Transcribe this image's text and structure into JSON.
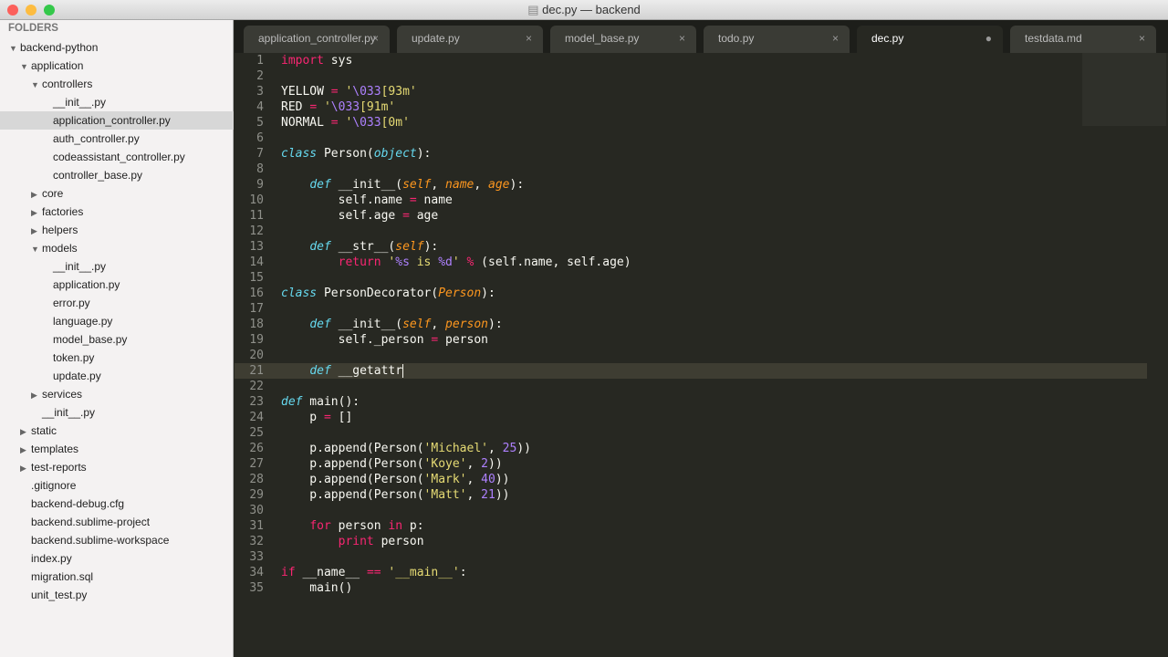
{
  "window": {
    "title": "dec.py — backend",
    "colors": {
      "close": "#fc605b",
      "min": "#fdbc40",
      "max": "#34c84a"
    }
  },
  "sidebar": {
    "header": "FOLDERS",
    "items": [
      {
        "label": "backend-python",
        "depth": 0,
        "arrow": "open"
      },
      {
        "label": "application",
        "depth": 1,
        "arrow": "open"
      },
      {
        "label": "controllers",
        "depth": 2,
        "arrow": "open"
      },
      {
        "label": "__init__.py",
        "depth": 3
      },
      {
        "label": "application_controller.py",
        "depth": 3,
        "selected": true
      },
      {
        "label": "auth_controller.py",
        "depth": 3
      },
      {
        "label": "codeassistant_controller.py",
        "depth": 3
      },
      {
        "label": "controller_base.py",
        "depth": 3
      },
      {
        "label": "core",
        "depth": 2,
        "arrow": "closed"
      },
      {
        "label": "factories",
        "depth": 2,
        "arrow": "closed"
      },
      {
        "label": "helpers",
        "depth": 2,
        "arrow": "closed"
      },
      {
        "label": "models",
        "depth": 2,
        "arrow": "open"
      },
      {
        "label": "__init__.py",
        "depth": 3
      },
      {
        "label": "application.py",
        "depth": 3
      },
      {
        "label": "error.py",
        "depth": 3
      },
      {
        "label": "language.py",
        "depth": 3
      },
      {
        "label": "model_base.py",
        "depth": 3
      },
      {
        "label": "token.py",
        "depth": 3
      },
      {
        "label": "update.py",
        "depth": 3
      },
      {
        "label": "services",
        "depth": 2,
        "arrow": "closed"
      },
      {
        "label": "__init__.py",
        "depth": 2
      },
      {
        "label": "static",
        "depth": 1,
        "arrow": "closed"
      },
      {
        "label": "templates",
        "depth": 1,
        "arrow": "closed"
      },
      {
        "label": "test-reports",
        "depth": 1,
        "arrow": "closed"
      },
      {
        "label": ".gitignore",
        "depth": 1
      },
      {
        "label": "backend-debug.cfg",
        "depth": 1
      },
      {
        "label": "backend.sublime-project",
        "depth": 1
      },
      {
        "label": "backend.sublime-workspace",
        "depth": 1
      },
      {
        "label": "index.py",
        "depth": 1
      },
      {
        "label": "migration.sql",
        "depth": 1
      },
      {
        "label": "unit_test.py",
        "depth": 1
      }
    ]
  },
  "tabs": [
    {
      "label": "application_controller.py",
      "close": "×"
    },
    {
      "label": "update.py",
      "close": "×"
    },
    {
      "label": "model_base.py",
      "close": "×"
    },
    {
      "label": "todo.py",
      "close": "×"
    },
    {
      "label": "dec.py",
      "close": "●",
      "active": true
    },
    {
      "label": "testdata.md",
      "close": "×"
    }
  ],
  "editor": {
    "current_line": 21,
    "lines": [
      [
        [
          "import",
          "k"
        ],
        [
          " sys",
          ""
        ]
      ],
      [],
      [
        [
          "YELLOW ",
          ""
        ],
        [
          "=",
          "k"
        ],
        [
          " '",
          "s"
        ],
        [
          "\\033",
          "n"
        ],
        [
          "[93m'",
          "s"
        ]
      ],
      [
        [
          "RED ",
          ""
        ],
        [
          "=",
          "k"
        ],
        [
          " '",
          "s"
        ],
        [
          "\\033",
          "n"
        ],
        [
          "[91m'",
          "s"
        ]
      ],
      [
        [
          "NORMAL ",
          ""
        ],
        [
          "=",
          "k"
        ],
        [
          " '",
          "s"
        ],
        [
          "\\033",
          "n"
        ],
        [
          "[0m'",
          "s"
        ]
      ],
      [],
      [
        [
          "class",
          "t"
        ],
        [
          " Person(",
          ""
        ],
        [
          "object",
          "t"
        ],
        [
          "):",
          ""
        ]
      ],
      [],
      [
        [
          "    ",
          ""
        ],
        [
          "def",
          "t"
        ],
        [
          " __init__(",
          ""
        ],
        [
          "self",
          "p"
        ],
        [
          ", ",
          ""
        ],
        [
          "name",
          "p"
        ],
        [
          ", ",
          ""
        ],
        [
          "age",
          "p"
        ],
        [
          "):",
          ""
        ]
      ],
      [
        [
          "        self.name ",
          ""
        ],
        [
          "=",
          "k"
        ],
        [
          " name",
          ""
        ]
      ],
      [
        [
          "        self.age ",
          ""
        ],
        [
          "=",
          "k"
        ],
        [
          " age",
          ""
        ]
      ],
      [],
      [
        [
          "    ",
          ""
        ],
        [
          "def",
          "t"
        ],
        [
          " __str__(",
          ""
        ],
        [
          "self",
          "p"
        ],
        [
          "):",
          ""
        ]
      ],
      [
        [
          "        ",
          ""
        ],
        [
          "return",
          "k"
        ],
        [
          " '",
          "s"
        ],
        [
          "%s",
          "n"
        ],
        [
          " is ",
          "s"
        ],
        [
          "%d",
          "n"
        ],
        [
          "'",
          "s"
        ],
        [
          " %",
          "k"
        ],
        [
          " (self.name, self.age)",
          ""
        ]
      ],
      [],
      [
        [
          "class",
          "t"
        ],
        [
          " PersonDecorator(",
          ""
        ],
        [
          "Person",
          "p"
        ],
        [
          "):",
          ""
        ]
      ],
      [],
      [
        [
          "    ",
          ""
        ],
        [
          "def",
          "t"
        ],
        [
          " __init__(",
          ""
        ],
        [
          "self",
          "p"
        ],
        [
          ", ",
          ""
        ],
        [
          "person",
          "p"
        ],
        [
          "):",
          ""
        ]
      ],
      [
        [
          "        self._person ",
          ""
        ],
        [
          "=",
          "k"
        ],
        [
          " person",
          ""
        ]
      ],
      [],
      [
        [
          "    ",
          ""
        ],
        [
          "def",
          "t"
        ],
        [
          " __getattr",
          ""
        ]
      ],
      [],
      [
        [
          "def",
          "t"
        ],
        [
          " main():",
          ""
        ]
      ],
      [
        [
          "    p ",
          ""
        ],
        [
          "=",
          "k"
        ],
        [
          " []",
          ""
        ]
      ],
      [],
      [
        [
          "    p.append(Person(",
          ""
        ],
        [
          "'Michael'",
          "s"
        ],
        [
          ", ",
          ""
        ],
        [
          "25",
          "n"
        ],
        [
          "))",
          ""
        ]
      ],
      [
        [
          "    p.append(Person(",
          ""
        ],
        [
          "'Koye'",
          "s"
        ],
        [
          ", ",
          ""
        ],
        [
          "2",
          "n"
        ],
        [
          "))",
          ""
        ]
      ],
      [
        [
          "    p.append(Person(",
          ""
        ],
        [
          "'Mark'",
          "s"
        ],
        [
          ", ",
          ""
        ],
        [
          "40",
          "n"
        ],
        [
          "))",
          ""
        ]
      ],
      [
        [
          "    p.append(Person(",
          ""
        ],
        [
          "'Matt'",
          "s"
        ],
        [
          ", ",
          ""
        ],
        [
          "21",
          "n"
        ],
        [
          "))",
          ""
        ]
      ],
      [],
      [
        [
          "    ",
          ""
        ],
        [
          "for",
          "k"
        ],
        [
          " person ",
          ""
        ],
        [
          "in",
          "k"
        ],
        [
          " p:",
          ""
        ]
      ],
      [
        [
          "        ",
          ""
        ],
        [
          "print",
          "k"
        ],
        [
          " person",
          ""
        ]
      ],
      [],
      [
        [
          "if",
          "k"
        ],
        [
          " __name__ ",
          ""
        ],
        [
          "==",
          "k"
        ],
        [
          " '__main__'",
          "s"
        ],
        [
          ":",
          ""
        ]
      ],
      [
        [
          "    main()",
          ""
        ]
      ]
    ]
  }
}
